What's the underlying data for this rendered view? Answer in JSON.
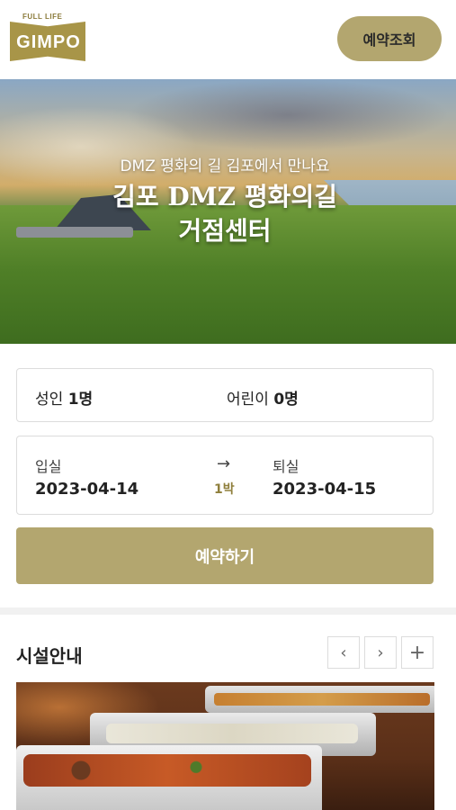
{
  "header": {
    "logo_top": "FULL LIFE",
    "logo_word": "GIMPO",
    "reserve_check_label": "예약조회"
  },
  "hero": {
    "subtitle": "DMZ 평화의 길 김포에서 만나요",
    "title_line1": "김포 DMZ 평화의길",
    "title_line2": "거점센터"
  },
  "booking": {
    "adult_label": "성인",
    "adult_count": "1명",
    "child_label": "어린이",
    "child_count": "0명",
    "checkin_label": "입실",
    "checkin_date": "2023-04-14",
    "arrow": "→",
    "nights": "1박",
    "checkout_label": "퇴실",
    "checkout_date": "2023-04-15",
    "book_button": "예약하기"
  },
  "facility": {
    "title": "시설안내",
    "prev": "‹",
    "next": "›",
    "more": "+"
  },
  "colors": {
    "accent": "#b3a66f",
    "logo": "#a89548",
    "nights_text": "#8f7f3c"
  }
}
